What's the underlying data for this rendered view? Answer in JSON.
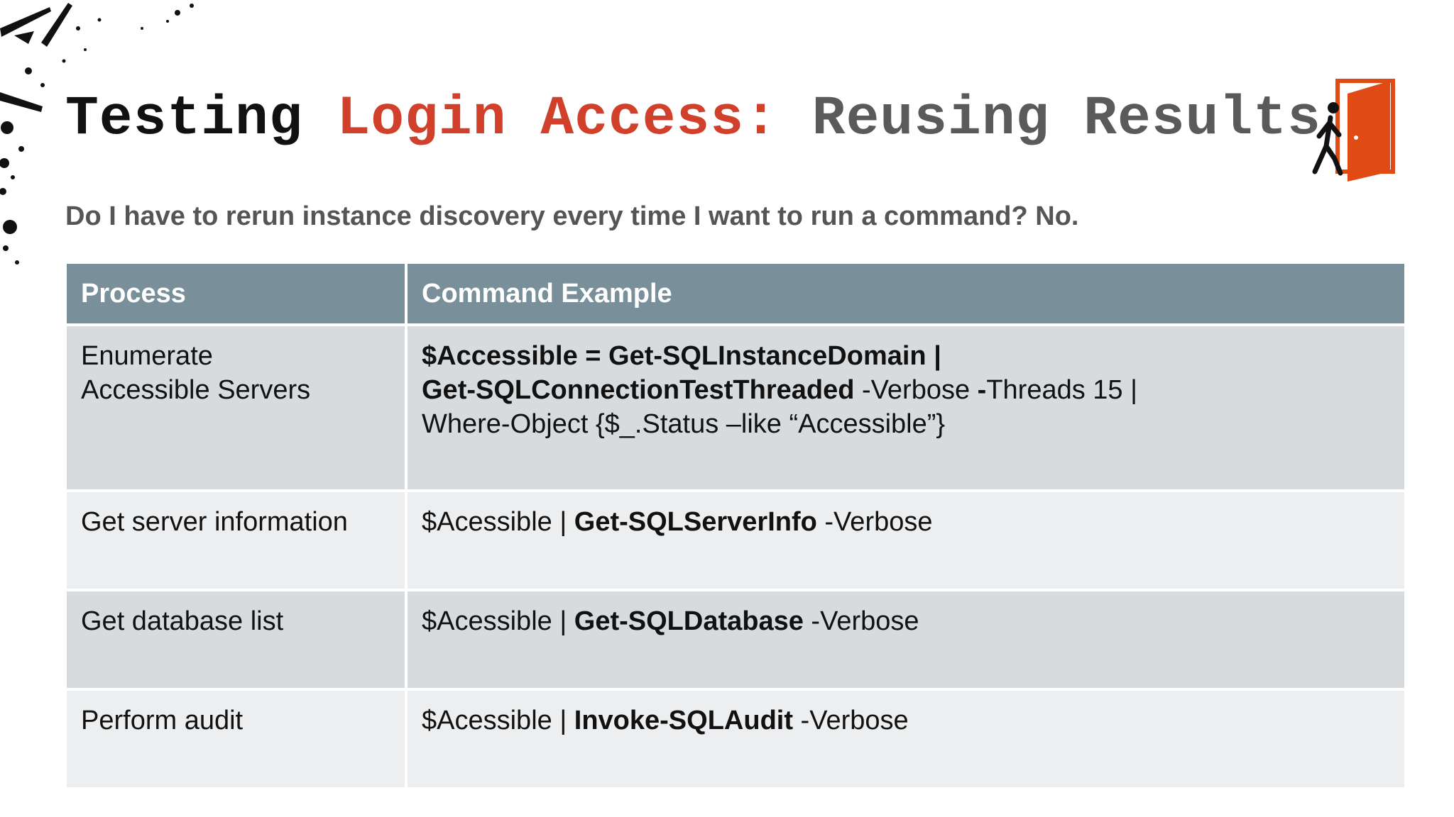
{
  "title": {
    "part1": "Testing",
    "part2": "Login Access:",
    "part3": "Reusing Results"
  },
  "subtitle": "Do I have to rerun instance discovery every time I want to run a command? No.",
  "table": {
    "headers": [
      "Process",
      "Command Example"
    ],
    "rows": [
      {
        "process_lines": [
          "Enumerate",
          "Accessible Servers"
        ],
        "command": {
          "line1_bold": "$Accessible = Get-SQLInstanceDomain |",
          "line2_bold": "Get-SQLConnectionTestThreaded",
          "line2_mid": " -Verbose ",
          "line2_bold2": "-",
          "line2_rest": "Threads 15 |",
          "line3": "Where-Object {$_.Status –like “Accessible”}"
        }
      },
      {
        "process": "Get server information",
        "cmd_prefix": "$Acessible | ",
        "cmd_bold": "Get-SQLServerInfo",
        "cmd_suffix": " -Verbose"
      },
      {
        "process": "Get database list",
        "cmd_prefix": "$Acessible | ",
        "cmd_bold": "Get-SQLDatabase",
        "cmd_suffix": " -Verbose"
      },
      {
        "process": "Perform audit",
        "cmd_prefix": "$Acessible | ",
        "cmd_bold": "Invoke-SQLAudit",
        "cmd_suffix": " -Verbose"
      }
    ]
  },
  "icons": {
    "exit": "walking-person-exit-door-icon",
    "splatter": "ink-splatter-decoration"
  },
  "colors": {
    "accent_red": "#d0402a",
    "door_orange": "#e04a14",
    "header_bg": "#79909b",
    "row_dark": "#d7dbde",
    "row_light": "#eceef0"
  }
}
